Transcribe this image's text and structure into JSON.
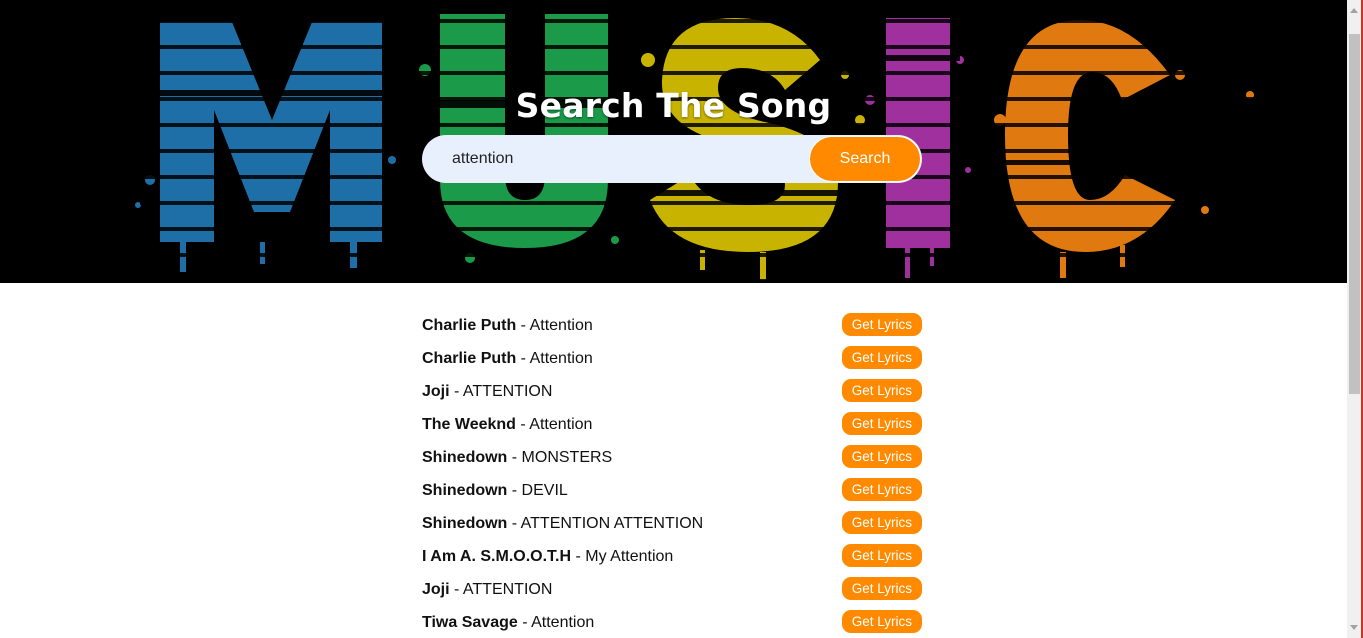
{
  "hero": {
    "title": "Search The Song",
    "background_art": "MUSIC",
    "letter_colors": [
      "#1e6fa8",
      "#1b9a4a",
      "#c8b400",
      "#a0309e",
      "#e07a10"
    ]
  },
  "search": {
    "value": "attention",
    "button_label": "Search",
    "icon": "search-icon"
  },
  "results": [
    {
      "artist": "Charlie Puth",
      "separator": " - ",
      "title": "Attention",
      "button": "Get Lyrics"
    },
    {
      "artist": "Charlie Puth",
      "separator": " - ",
      "title": "Attention",
      "button": "Get Lyrics"
    },
    {
      "artist": "Joji",
      "separator": " - ",
      "title": "ATTENTION",
      "button": "Get Lyrics"
    },
    {
      "artist": "The Weeknd",
      "separator": " - ",
      "title": "Attention",
      "button": "Get Lyrics"
    },
    {
      "artist": "Shinedown",
      "separator": " - ",
      "title": "MONSTERS",
      "button": "Get Lyrics"
    },
    {
      "artist": "Shinedown",
      "separator": " - ",
      "title": "DEVIL",
      "button": "Get Lyrics"
    },
    {
      "artist": "Shinedown",
      "separator": " - ",
      "title": "ATTENTION ATTENTION",
      "button": "Get Lyrics"
    },
    {
      "artist": "I Am A. S.M.O.O.T.H",
      "separator": " - ",
      "title": "My Attention",
      "button": "Get Lyrics"
    },
    {
      "artist": "Joji",
      "separator": " - ",
      "title": "ATTENTION",
      "button": "Get Lyrics"
    },
    {
      "artist": "Tiwa Savage",
      "separator": " - ",
      "title": "Attention",
      "button": "Get Lyrics"
    }
  ],
  "colors": {
    "accent": "#ff8a00",
    "search_bg": "#e8f0fe",
    "hero_bg": "#000000"
  }
}
